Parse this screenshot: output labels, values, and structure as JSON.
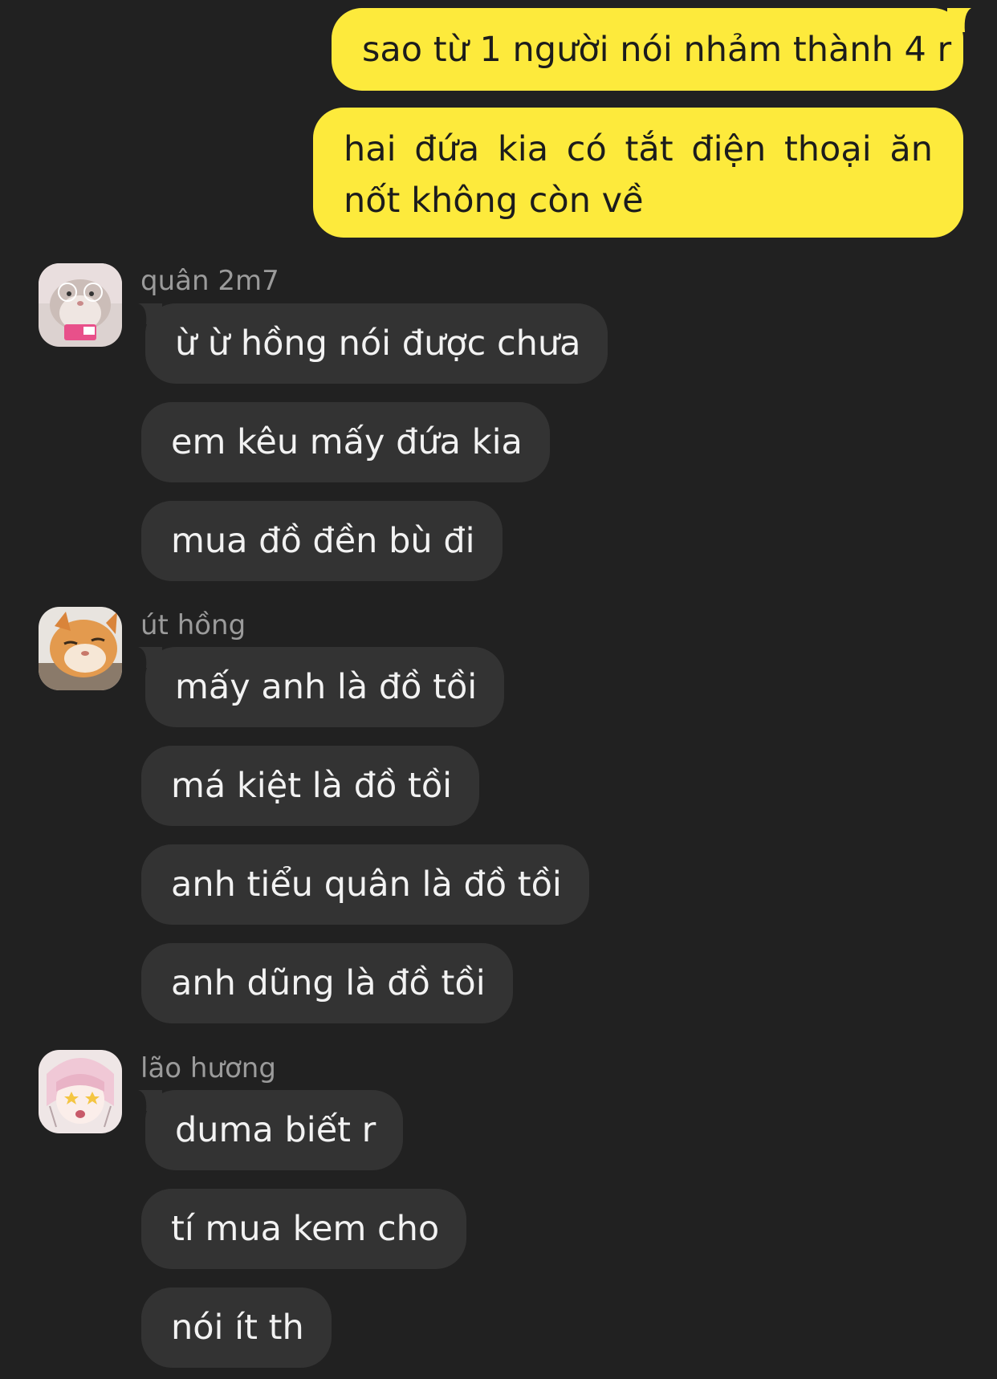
{
  "colors": {
    "background": "#212121",
    "outgoing_bubble": "#fdea3c",
    "incoming_bubble": "#333333",
    "sender_name": "#9b9b9b"
  },
  "outgoing": [
    {
      "text": "sao từ 1 người nói nhảm thành 4 r"
    },
    {
      "text": "hai đứa kia có tắt điện thoại ăn nốt không còn về"
    }
  ],
  "groups": [
    {
      "sender": "quân 2m7",
      "avatar": "hamster-avatar",
      "messages": [
        {
          "text": "ừ ừ hồng nói được chưa"
        },
        {
          "text": "em kêu mấy đứa kia"
        },
        {
          "text": "mua đồ đền bù đi"
        }
      ]
    },
    {
      "sender": "út hồng",
      "avatar": "cat-avatar",
      "messages": [
        {
          "text": "mấy anh là đồ tồi"
        },
        {
          "text": "má kiệt là đồ tồi"
        },
        {
          "text": "anh tiểu quân là đồ tồi"
        },
        {
          "text": "anh dũng là đồ tồi"
        }
      ]
    },
    {
      "sender": "lão hương",
      "avatar": "anime-girl-avatar",
      "messages": [
        {
          "text": "duma biết r"
        },
        {
          "text": "tí mua kem cho"
        },
        {
          "text": "nói ít th"
        }
      ]
    }
  ]
}
